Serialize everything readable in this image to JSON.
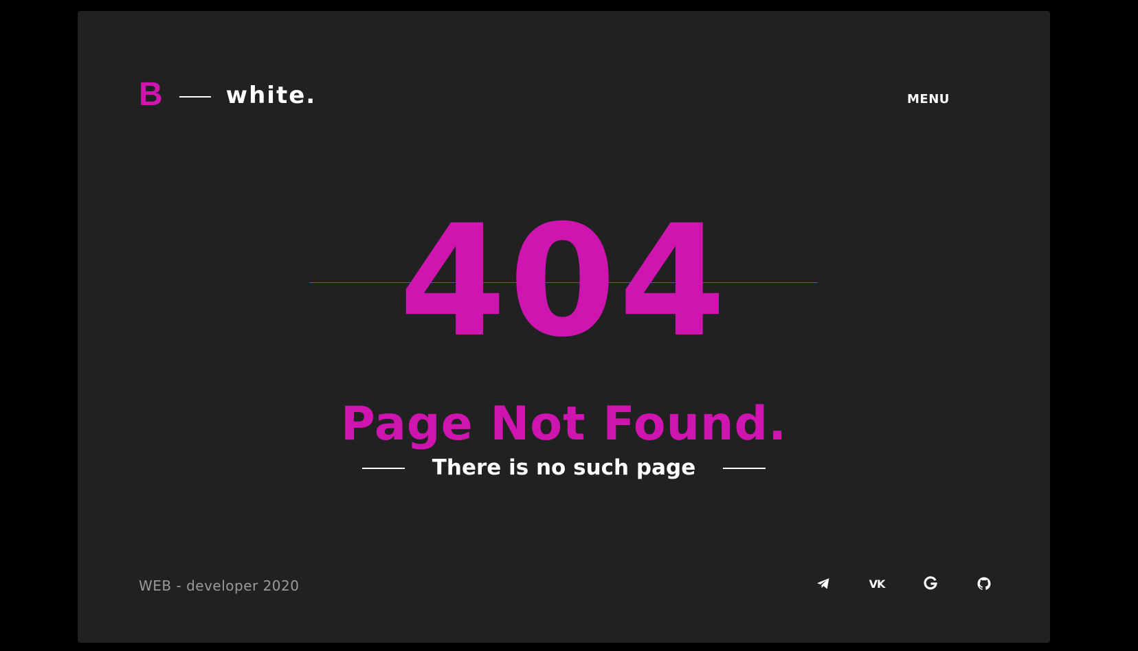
{
  "header": {
    "logo_letter": "B",
    "logo_word": "white.",
    "menu_label": "MENU"
  },
  "main": {
    "code": "404",
    "title": "Page Not Found.",
    "subtitle": "There is no such page"
  },
  "footer": {
    "text": "WEB - developer 2020",
    "social": [
      {
        "icon": "telegram-icon"
      },
      {
        "icon": "vk-icon",
        "glyph": "VK"
      },
      {
        "icon": "google-icon"
      },
      {
        "icon": "github-icon"
      }
    ]
  },
  "colors": {
    "background": "#000000",
    "card": "#212121",
    "accent": "#cf15b0",
    "text": "#ffffff",
    "muted": "#9a9a9a"
  }
}
